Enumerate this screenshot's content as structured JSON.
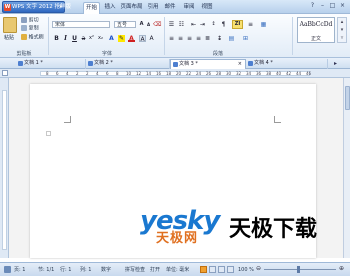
{
  "titlebar": {
    "app_label": "WPS 文字 2012 抢鲜版",
    "tabs": [
      "开始",
      "插入",
      "页面布局",
      "引用",
      "邮件",
      "审阅",
      "视图"
    ]
  },
  "ribbon": {
    "clipboard": {
      "cut": "剪切",
      "copy": "复制",
      "format_painter": "格式刷",
      "paste": "粘贴",
      "label": "剪贴板"
    },
    "font": {
      "name": "宋体",
      "size": "五号",
      "label": "字体"
    },
    "paragraph": {
      "label": "段落"
    },
    "styles": {
      "preview": "AaBbCcDd",
      "name": "正文"
    }
  },
  "doc_tabs": [
    {
      "label": "文档 1 *"
    },
    {
      "label": "文档 2 *"
    },
    {
      "label": "文档 3 *"
    },
    {
      "label": "文档 4 *"
    }
  ],
  "ruler_numbers": [
    "8",
    "6",
    "4",
    "2",
    "2",
    "4",
    "6",
    "8",
    "10",
    "12",
    "14",
    "16",
    "18",
    "20",
    "22",
    "24",
    "26",
    "28",
    "30",
    "32",
    "34",
    "36",
    "38",
    "40",
    "42",
    "44",
    "46"
  ],
  "statusbar": {
    "page": "页: 1",
    "section": "节: 1/1",
    "row": "行: 1",
    "col": "列: 1",
    "digits": "数字",
    "spellcheck": "拼写检查",
    "print": "打开",
    "units": "单位: 毫米",
    "zoom": "100 %"
  },
  "watermark": {
    "brand": "yesky",
    "cn": "天极网",
    "cn2": "天极下载"
  },
  "colors": {
    "accent": "#2f68c0",
    "ribbon_bg": "#e2ecf7",
    "tab_bar": "#cfdff1"
  }
}
